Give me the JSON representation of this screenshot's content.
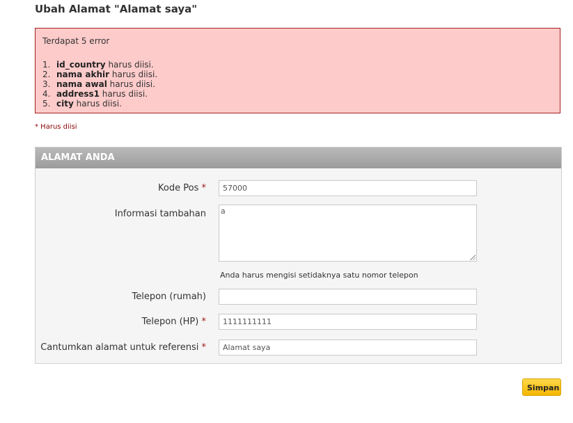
{
  "page": {
    "title": "Ubah Alamat \"Alamat saya\""
  },
  "errors": {
    "summary": "Terdapat 5 error",
    "items": [
      {
        "num": "1.",
        "field": "id_country",
        "message": " harus diisi."
      },
      {
        "num": "2.",
        "field": "nama akhir",
        "message": " harus diisi."
      },
      {
        "num": "3.",
        "field": "nama awal",
        "message": " harus diisi."
      },
      {
        "num": "4.",
        "field": "address1",
        "message": " harus diisi."
      },
      {
        "num": "5.",
        "field": "city",
        "message": " harus diisi."
      }
    ]
  },
  "required_note": "* Harus diisi",
  "section": {
    "title": "ALAMAT ANDA"
  },
  "form": {
    "required_marker": "*",
    "kode_pos": {
      "label": "Kode Pos",
      "value": "57000"
    },
    "info": {
      "label": "Informasi tambahan",
      "value": "a"
    },
    "phone_hint": "Anda harus mengisi setidaknya satu nomor telepon",
    "telepon_rumah": {
      "label": "Telepon (rumah)",
      "value": ""
    },
    "telepon_hp": {
      "label": "Telepon (HP)",
      "value": "1111111111"
    },
    "alias": {
      "label": "Cantumkan alamat untuk referensi",
      "value": "Alamat saya"
    }
  },
  "actions": {
    "save_label": "Simpan"
  },
  "colors": {
    "error_bg": "#fecbcb",
    "error_border": "#a41e1e",
    "required": "#a01818",
    "button": "#f4b500"
  }
}
